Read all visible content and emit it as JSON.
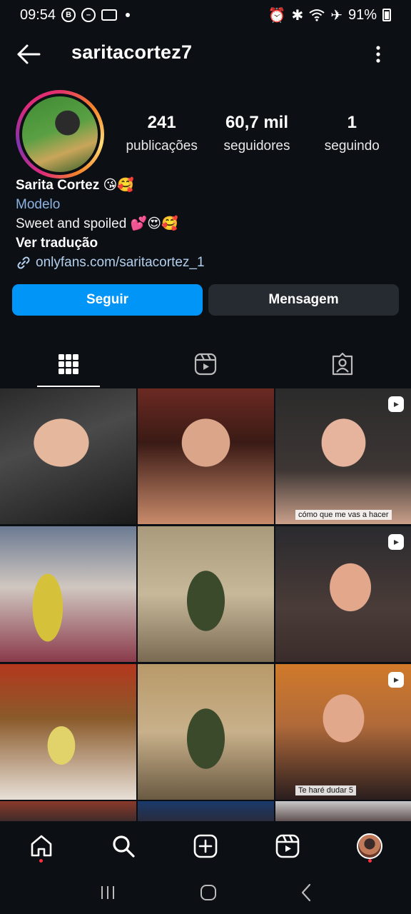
{
  "status": {
    "time": "09:54",
    "battery": "91%"
  },
  "header": {
    "username": "saritacortez7"
  },
  "profile": {
    "stats": [
      {
        "value": "241",
        "label": "publicações"
      },
      {
        "value": "60,7 mil",
        "label": "seguidores"
      },
      {
        "value": "1",
        "label": "seguindo"
      }
    ],
    "name": "Sarita Cortez 😘🥰",
    "category": "Modelo",
    "bio": "Sweet and spoiled  💕😍🥰",
    "translate": "Ver tradução",
    "link": "onlyfans.com/saritacortez_1"
  },
  "actions": {
    "follow": "Seguir",
    "message": "Mensagem"
  },
  "grid": {
    "captions": {
      "c3": "cómo que me vas a hacer",
      "c9": "Te haré dudar 5"
    }
  },
  "colors": {
    "background": "#0c0f14",
    "accent": "#0095f6",
    "link": "#b3cfee",
    "category": "#8db4e3"
  }
}
